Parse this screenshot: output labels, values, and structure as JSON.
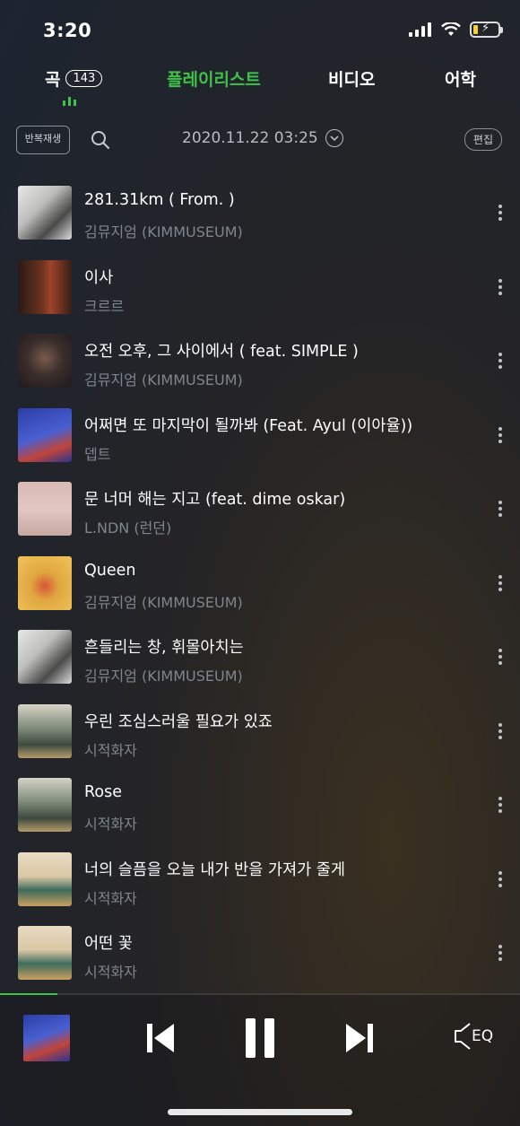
{
  "status_bar": {
    "time": "3:20"
  },
  "tabs": {
    "songs_label": "곡",
    "songs_count": "143",
    "playlist_label": "플레이리스트",
    "video_label": "비디오",
    "language_label": "어학",
    "active_tab": "playlist"
  },
  "toolbar": {
    "repeat_label": "반복재생",
    "date_filter": "2020.11.22 03:25",
    "edit_label": "편집"
  },
  "songs": [
    {
      "title": "281.31km ( From. )",
      "artist": "김뮤지엄 (KIMMUSEUM)"
    },
    {
      "title": "이사",
      "artist": "크르르"
    },
    {
      "title": "오전 오후, 그 사이에서 ( feat. SIMPLE )",
      "artist": "김뮤지엄 (KIMMUSEUM)"
    },
    {
      "title": "어쩌면 또 마지막이 될까봐 (Feat. Ayul (이아율))",
      "artist": "뎁트"
    },
    {
      "title": "문 너머 해는 지고 (feat. dime oskar)",
      "artist": "L.NDN (런던)"
    },
    {
      "title": "Queen",
      "artist": "김뮤지엄 (KIMMUSEUM)"
    },
    {
      "title": "흔들리는 창, 휘몰아치는",
      "artist": "김뮤지엄 (KIMMUSEUM)"
    },
    {
      "title": "우린 조심스러울 필요가 있죠",
      "artist": "시적화자"
    },
    {
      "title": "Rose",
      "artist": "시적화자"
    },
    {
      "title": "너의 슬픔을 오늘 내가 반을 가져가 줄게",
      "artist": "시적화자"
    },
    {
      "title": "어떤 꽃",
      "artist": "시적화자"
    }
  ],
  "player": {
    "eq_label": "EQ",
    "progress": 0.11
  },
  "colors": {
    "accent": "#3fc14a",
    "secondary_text": "#7e858c"
  }
}
